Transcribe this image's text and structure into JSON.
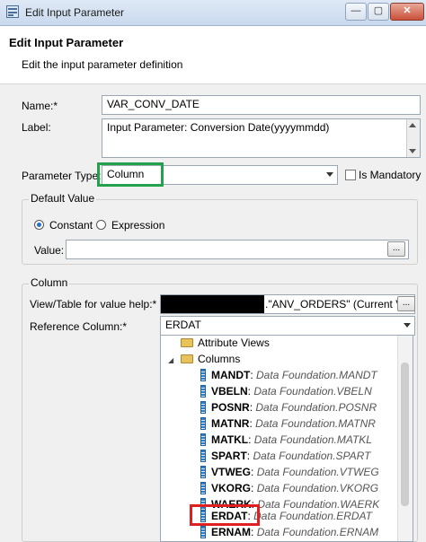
{
  "window": {
    "title": "Edit Input Parameter",
    "minimize": "—",
    "maximize": "▢",
    "close": "✕"
  },
  "header": {
    "title": "Edit Input Parameter",
    "subtitle": "Edit the input parameter definition"
  },
  "form": {
    "name_label": "Name:*",
    "name_value": "VAR_CONV_DATE",
    "label_label": "Label:",
    "label_value": "Input Parameter: Conversion Date(yyyymmdd)",
    "param_type_label": "Parameter Type:",
    "param_type_value": "Column",
    "mandatory_label": "Is Mandatory"
  },
  "default_value": {
    "group_label": "Default Value",
    "constant_label": "Constant",
    "expression_label": "Expression",
    "value_label": "Value:",
    "value_value": "",
    "browse_label": "..."
  },
  "column": {
    "group_label": "Column",
    "view_label": "View/Table for value help:*",
    "view_value": ".\"ANV_ORDERS\" (Current View",
    "browse_label": "...",
    "ref_label": "Reference Column:*",
    "ref_value": "ERDAT"
  },
  "tree": {
    "attribute_views": "Attribute Views",
    "columns": "Columns",
    "items": [
      {
        "name": "MANDT",
        "path": "Data Foundation.MANDT"
      },
      {
        "name": "VBELN",
        "path": "Data Foundation.VBELN"
      },
      {
        "name": "POSNR",
        "path": "Data Foundation.POSNR"
      },
      {
        "name": "MATNR",
        "path": "Data Foundation.MATNR"
      },
      {
        "name": "MATKL",
        "path": "Data Foundation.MATKL"
      },
      {
        "name": "SPART",
        "path": "Data Foundation.SPART"
      },
      {
        "name": "VTWEG",
        "path": "Data Foundation.VTWEG"
      },
      {
        "name": "VKORG",
        "path": "Data Foundation.VKORG"
      },
      {
        "name": "WAERK",
        "path": "Data Foundation.WAERK"
      },
      {
        "name": "ERDAT",
        "path": "Data Foundation.ERDAT"
      },
      {
        "name": "ERNAM",
        "path": "Data Foundation.ERNAM"
      }
    ],
    "colon": ":"
  },
  "colors": {
    "highlight_green": "#22a24a",
    "highlight_red": "#e02020"
  }
}
